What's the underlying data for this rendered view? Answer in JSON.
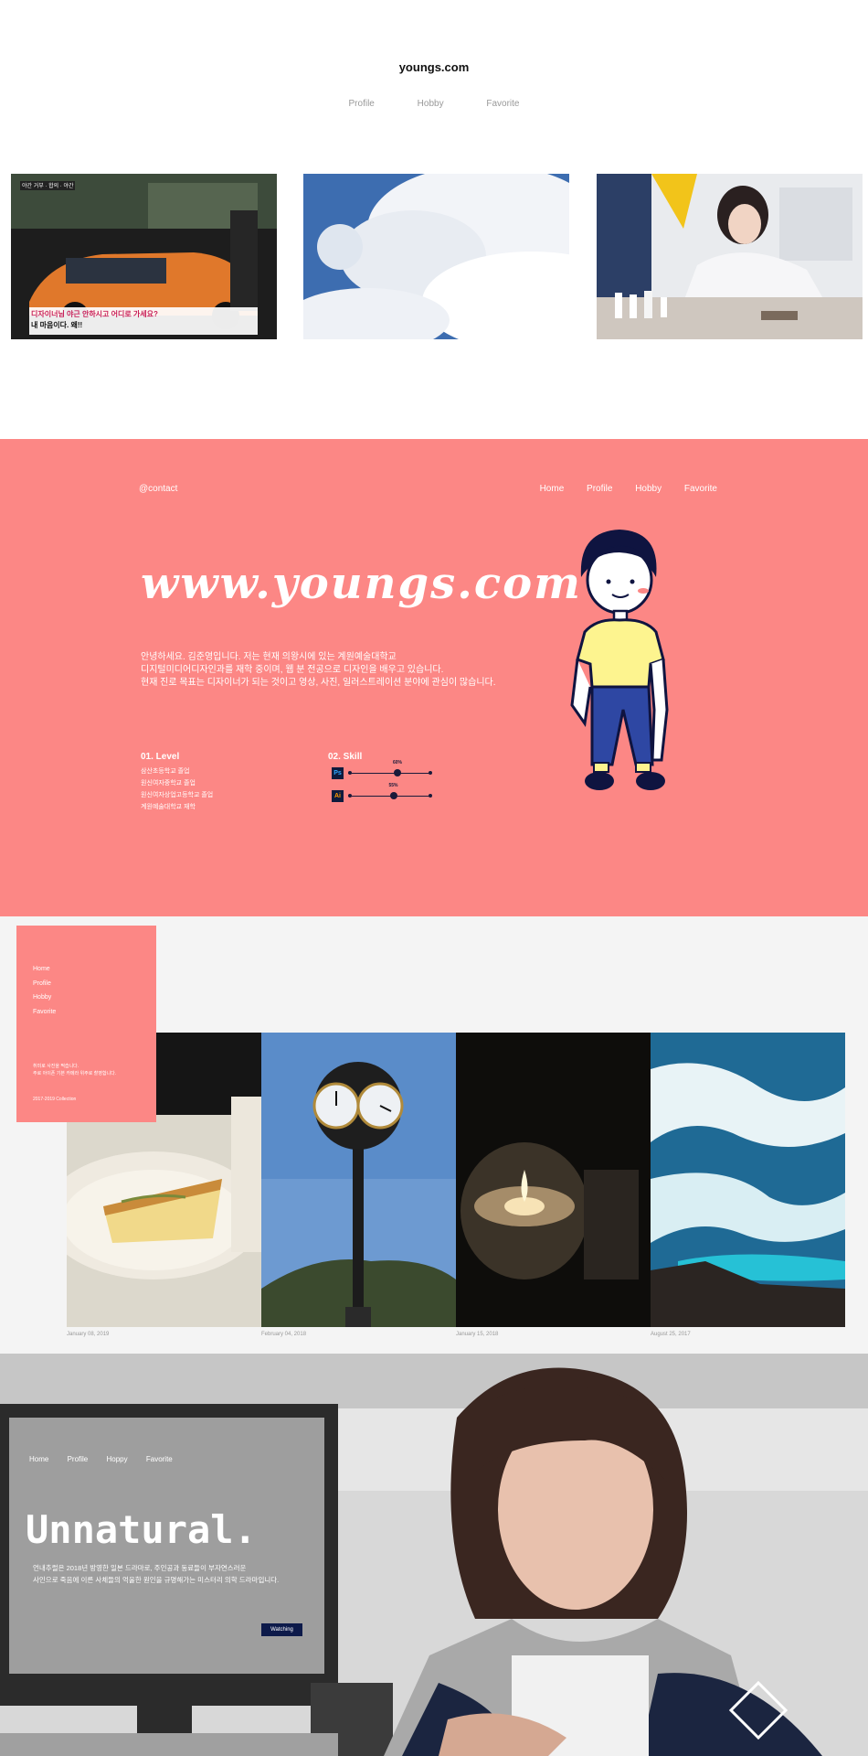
{
  "header": {
    "site_title": "youngs.com",
    "nav": [
      "Profile",
      "Hobby",
      "Favorite"
    ]
  },
  "thumbnails": [
    {
      "name": "news-capture",
      "tag": "야간 거부 · 합의 · 야간",
      "caption_1": "디자이너님 야근 안하시고 어디로 가세요?",
      "caption_2": "내 마음이다. 왜!!"
    },
    {
      "name": "clouds"
    },
    {
      "name": "actress-in-lab"
    }
  ],
  "intro": {
    "contact": "@contact",
    "nav": [
      "Home",
      "Profile",
      "Hobby",
      "Favorite"
    ],
    "title": "www.youngs.com",
    "paragraph": [
      "안녕하세요. 김준영입니다. 저는 현재 의왕시에 있는 계원예술대학교",
      "디지털미디어디자인과를 재학 중이며, 웹 분 전공으로 디자인을 배우고 있습니다.",
      "현재 진로 목표는 디자이너가 되는 것이고 영상, 사진, 일러스트레이션 분야에 관심이 많습니다."
    ],
    "level": {
      "heading": "01. Level",
      "items": [
        "삼산초등학교 졸업",
        "원신여자중학교 졸업",
        "원신여자상업고등학교 졸업",
        "계원예술대학교 재학"
      ]
    },
    "skill": {
      "heading": "02. Skill",
      "items": [
        {
          "icon": "Ps",
          "percent_label": "60%",
          "level": 0.6
        },
        {
          "icon": "Ai",
          "percent_label": "55%",
          "level": 0.55
        }
      ]
    }
  },
  "gallery": {
    "card": {
      "nav": [
        "Home",
        "Profile",
        "Hobby",
        "Favorite"
      ],
      "text_1": "취미로 사진을 찍습니다.",
      "text_2": "주로 아이폰 기본 카메라 위주로 촬영합니다.",
      "collection": "2017-2019 Collection"
    },
    "photos": [
      {
        "name": "cake",
        "date": "January 08, 2019"
      },
      {
        "name": "street-clock",
        "date": "February 04, 2018"
      },
      {
        "name": "candle",
        "date": "January 15, 2018"
      },
      {
        "name": "ocean",
        "date": "August 25, 2017"
      }
    ]
  },
  "hero": {
    "nav": [
      "Home",
      "Profile",
      "Hoppy",
      "Favorite"
    ],
    "title": "Unnatural.",
    "text_1": "언내추럴은 2018년 방영한 일본 드라마로, 주인공과 동료들이 부자연스러운",
    "text_2": "사인으로 죽음에 이른 사체들의 억울한 원인을 규명해가는 미스터리 의학 드라마입니다.",
    "button": "Watching"
  },
  "colors": {
    "accent_pink": "#fc8785",
    "navy": "#0d1a4a",
    "gallery_bg": "#f4f4f4"
  }
}
